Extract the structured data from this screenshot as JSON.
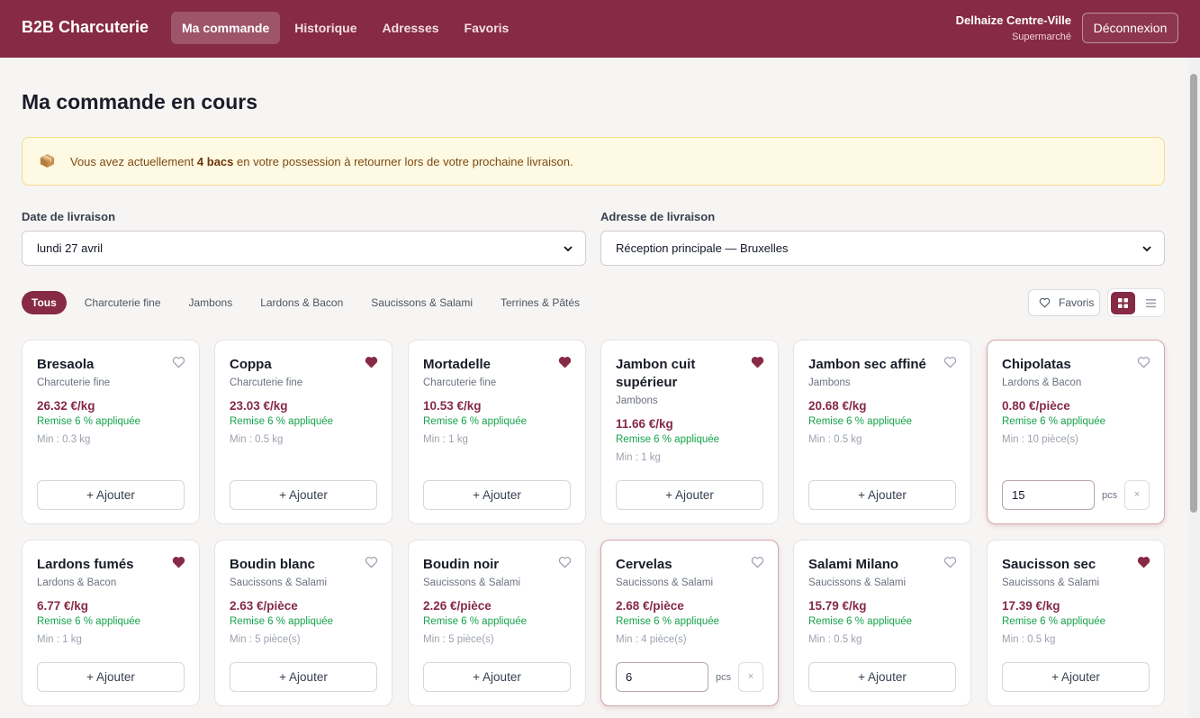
{
  "header": {
    "brand": "B2B Charcuterie",
    "nav": [
      {
        "label": "Ma commande",
        "active": true
      },
      {
        "label": "Historique",
        "active": false
      },
      {
        "label": "Adresses",
        "active": false
      },
      {
        "label": "Favoris",
        "active": false
      }
    ],
    "user_name": "Delhaize Centre-Ville",
    "user_role": "Supermarché",
    "logout_label": "Déconnexion"
  },
  "page": {
    "title": "Ma commande en cours"
  },
  "notice": {
    "icon": "box-icon",
    "prefix": "Vous avez actuellement ",
    "highlight": "4 bacs",
    "suffix": " en votre possession à retourner lors de votre prochaine livraison."
  },
  "delivery": {
    "date_label": "Date de livraison",
    "date_value": "lundi 27 avril",
    "address_label": "Adresse de livraison",
    "address_value": "Réception principale — Bruxelles"
  },
  "filters": {
    "categories": [
      {
        "label": "Tous",
        "active": true
      },
      {
        "label": "Charcuterie fine",
        "active": false
      },
      {
        "label": "Jambons",
        "active": false
      },
      {
        "label": "Lardons & Bacon",
        "active": false
      },
      {
        "label": "Saucissons & Salami",
        "active": false
      },
      {
        "label": "Terrines & Pâtés",
        "active": false
      }
    ],
    "favorites_label": "Favoris",
    "view_mode": "grid"
  },
  "labels": {
    "add": "+ Ajouter",
    "unit_pcs": "pcs",
    "remove": "×"
  },
  "products": [
    {
      "name": "Bresaola",
      "category": "Charcuterie fine",
      "price": "26.32 €/kg",
      "discount": "Remise 6 % appliquée",
      "min": "Min : 0.3 kg",
      "favorite": false,
      "qty": null
    },
    {
      "name": "Coppa",
      "category": "Charcuterie fine",
      "price": "23.03 €/kg",
      "discount": "Remise 6 % appliquée",
      "min": "Min : 0.5 kg",
      "favorite": true,
      "qty": null
    },
    {
      "name": "Mortadelle",
      "category": "Charcuterie fine",
      "price": "10.53 €/kg",
      "discount": "Remise 6 % appliquée",
      "min": "Min : 1 kg",
      "favorite": true,
      "qty": null
    },
    {
      "name": "Jambon cuit supérieur",
      "category": "Jambons",
      "price": "11.66 €/kg",
      "discount": "Remise 6 % appliquée",
      "min": "Min : 1 kg",
      "favorite": true,
      "qty": null
    },
    {
      "name": "Jambon sec affiné",
      "category": "Jambons",
      "price": "20.68 €/kg",
      "discount": "Remise 6 % appliquée",
      "min": "Min : 0.5 kg",
      "favorite": false,
      "qty": null
    },
    {
      "name": "Chipolatas",
      "category": "Lardons & Bacon",
      "price": "0.80 €/pièce",
      "discount": "Remise 6 % appliquée",
      "min": "Min : 10 pièce(s)",
      "favorite": false,
      "qty": "15"
    },
    {
      "name": "Lardons fumés",
      "category": "Lardons & Bacon",
      "price": "6.77 €/kg",
      "discount": "Remise 6 % appliquée",
      "min": "Min : 1 kg",
      "favorite": true,
      "qty": null
    },
    {
      "name": "Boudin blanc",
      "category": "Saucissons & Salami",
      "price": "2.63 €/pièce",
      "discount": "Remise 6 % appliquée",
      "min": "Min : 5 pièce(s)",
      "favorite": false,
      "qty": null
    },
    {
      "name": "Boudin noir",
      "category": "Saucissons & Salami",
      "price": "2.26 €/pièce",
      "discount": "Remise 6 % appliquée",
      "min": "Min : 5 pièce(s)",
      "favorite": false,
      "qty": null
    },
    {
      "name": "Cervelas",
      "category": "Saucissons & Salami",
      "price": "2.68 €/pièce",
      "discount": "Remise 6 % appliquée",
      "min": "Min : 4 pièce(s)",
      "favorite": false,
      "qty": "6"
    },
    {
      "name": "Salami Milano",
      "category": "Saucissons & Salami",
      "price": "15.79 €/kg",
      "discount": "Remise 6 % appliquée",
      "min": "Min : 0.5 kg",
      "favorite": false,
      "qty": null
    },
    {
      "name": "Saucisson sec",
      "category": "Saucissons & Salami",
      "price": "17.39 €/kg",
      "discount": "Remise 6 % appliquée",
      "min": "Min : 0.5 kg",
      "favorite": true,
      "qty": null
    }
  ],
  "colors": {
    "brand": "#862a45",
    "discount": "#16a34a",
    "notice_bg": "#fef9e2"
  }
}
